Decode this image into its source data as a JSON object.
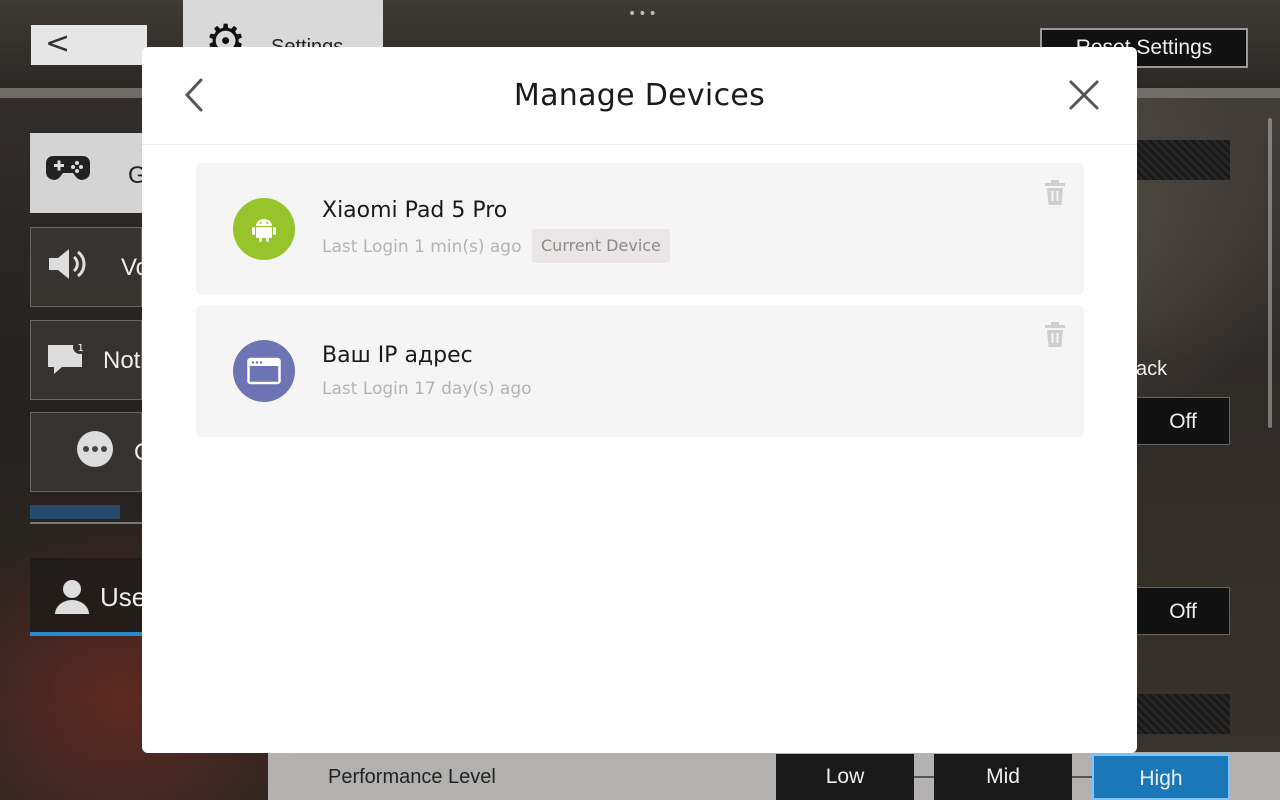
{
  "background": {
    "back_glyph": "<",
    "settings_tab_label": "Settings",
    "reset_button_label": "Reset Settings",
    "sidebar": {
      "items": [
        {
          "label": "G",
          "icon": "gamepad-icon"
        },
        {
          "label": "Vo",
          "icon": "speaker-icon"
        },
        {
          "label": "Noti",
          "icon": "chat-icon"
        },
        {
          "label": "O",
          "icon": "more-icon"
        }
      ],
      "user_label": "User"
    },
    "right_panel": {
      "partial_label": "ack",
      "toggle_1": "Off",
      "toggle_2": "Off"
    },
    "performance": {
      "label": "Performance Level",
      "options": [
        "Low",
        "Mid",
        "High"
      ],
      "selected": "High",
      "accent_color": "#1b78b8"
    }
  },
  "modal": {
    "title": "Manage Devices",
    "back_icon": "chevron-left-icon",
    "close_icon": "close-icon",
    "devices": [
      {
        "name": "Xiaomi Pad 5 Pro",
        "last_login": "Last Login 1 min(s) ago",
        "badge": "Current Device",
        "icon": "android-icon",
        "icon_color": "#97c42b"
      },
      {
        "name": "Ваш IP адрес",
        "last_login": "Last Login 17 day(s) ago",
        "icon": "browser-window-icon",
        "icon_color": "#6c74b4"
      }
    ]
  }
}
